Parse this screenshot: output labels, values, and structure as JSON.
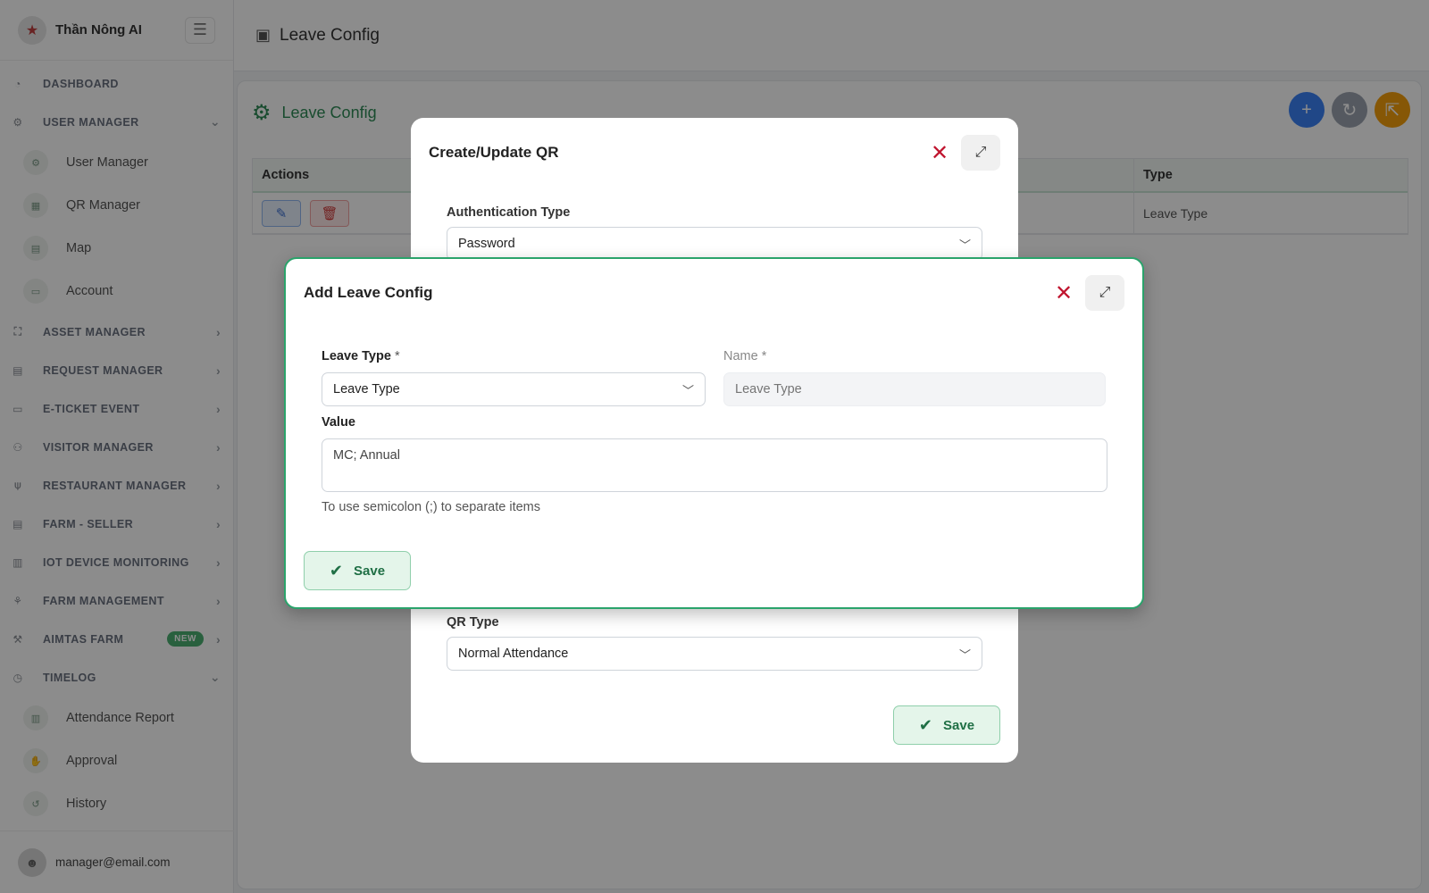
{
  "brand": {
    "name": "Thần Nông AI"
  },
  "sidebar": {
    "menu": [
      {
        "label": "DASHBOARD",
        "icon": "dashboard-icon",
        "glyph": "◔",
        "chevron": ""
      },
      {
        "label": "USER MANAGER",
        "icon": "users-cog-icon",
        "glyph": "⚙",
        "chevron": "⌄",
        "children": [
          {
            "label": "User Manager",
            "glyph": "⚙"
          },
          {
            "label": "QR Manager",
            "glyph": "▦"
          },
          {
            "label": "Map",
            "glyph": "▤"
          },
          {
            "label": "Account",
            "glyph": "▭"
          }
        ]
      },
      {
        "label": "ASSET MANAGER",
        "icon": "asset-icon",
        "glyph": "⛶",
        "chevron": "›"
      },
      {
        "label": "REQUEST MANAGER",
        "icon": "clipboard-icon",
        "glyph": "▤",
        "chevron": "›"
      },
      {
        "label": "E-TICKET EVENT",
        "icon": "ticket-icon",
        "glyph": "▭",
        "chevron": "›"
      },
      {
        "label": "VISITOR MANAGER",
        "icon": "visitors-icon",
        "glyph": "⚇",
        "chevron": "›"
      },
      {
        "label": "RESTAURANT MANAGER",
        "icon": "utensils-icon",
        "glyph": "⍦",
        "chevron": "›"
      },
      {
        "label": "FARM - SELLER",
        "icon": "store-icon",
        "glyph": "▤",
        "chevron": "›"
      },
      {
        "label": "IOT DEVICE MONITORING",
        "icon": "chart-icon",
        "glyph": "▥",
        "chevron": "›"
      },
      {
        "label": "FARM MANAGEMENT",
        "icon": "farm-icon",
        "glyph": "⚘",
        "chevron": "›"
      },
      {
        "label": "AIMTAS FARM",
        "icon": "tractor-icon",
        "glyph": "⚒",
        "chevron": "›",
        "badge": "NEW"
      },
      {
        "label": "TIMELOG",
        "icon": "clock-icon",
        "glyph": "◷",
        "chevron": "⌄",
        "children": [
          {
            "label": "Attendance Report",
            "glyph": "▥"
          },
          {
            "label": "Approval",
            "glyph": "✋"
          },
          {
            "label": "History",
            "glyph": "↺"
          }
        ]
      }
    ]
  },
  "user": {
    "email": "manager@email.com"
  },
  "topbar": {
    "title": "Leave Config"
  },
  "card": {
    "title": "Leave Config",
    "table": {
      "headers": {
        "actions": "Actions",
        "type": "Type"
      },
      "rows": [
        {
          "type": "Leave Type"
        }
      ]
    }
  },
  "qr_modal": {
    "title": "Create/Update QR",
    "auth_label": "Authentication Type",
    "auth_value": "Password",
    "qr_type_label": "QR Type",
    "qr_type_value": "Normal Attendance",
    "save_label": "Save"
  },
  "leave_modal": {
    "title": "Add Leave Config",
    "leave_type_label": "Leave Type",
    "leave_type_value": "Leave Type",
    "name_label": "Name",
    "name_placeholder": "Leave Type",
    "required_mark": "*",
    "value_label": "Value",
    "value_text": "MC; Annual",
    "hint": "To use semicolon (;) to separate items",
    "save_label": "Save"
  },
  "colors": {
    "accent": "#2e8b57",
    "danger": "#c0152f",
    "primary": "#3b82f6"
  }
}
